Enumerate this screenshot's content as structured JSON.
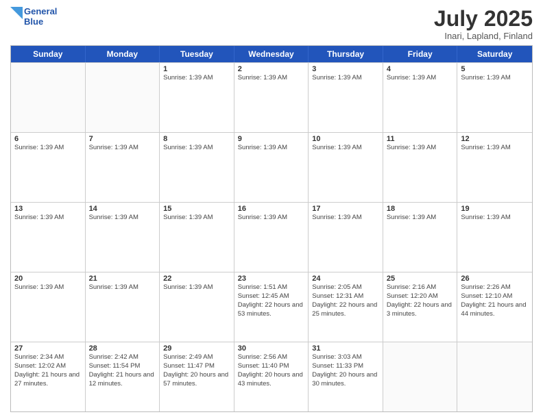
{
  "logo": {
    "line1": "General",
    "line2": "Blue"
  },
  "title": "July 2025",
  "location": "Inari, Lapland, Finland",
  "header_days": [
    "Sunday",
    "Monday",
    "Tuesday",
    "Wednesday",
    "Thursday",
    "Friday",
    "Saturday"
  ],
  "weeks": [
    [
      {
        "day": "",
        "info": ""
      },
      {
        "day": "",
        "info": ""
      },
      {
        "day": "1",
        "info": "Sunrise: 1:39 AM"
      },
      {
        "day": "2",
        "info": "Sunrise: 1:39 AM"
      },
      {
        "day": "3",
        "info": "Sunrise: 1:39 AM"
      },
      {
        "day": "4",
        "info": "Sunrise: 1:39 AM"
      },
      {
        "day": "5",
        "info": "Sunrise: 1:39 AM"
      }
    ],
    [
      {
        "day": "6",
        "info": "Sunrise: 1:39 AM"
      },
      {
        "day": "7",
        "info": "Sunrise: 1:39 AM"
      },
      {
        "day": "8",
        "info": "Sunrise: 1:39 AM"
      },
      {
        "day": "9",
        "info": "Sunrise: 1:39 AM"
      },
      {
        "day": "10",
        "info": "Sunrise: 1:39 AM"
      },
      {
        "day": "11",
        "info": "Sunrise: 1:39 AM"
      },
      {
        "day": "12",
        "info": "Sunrise: 1:39 AM"
      }
    ],
    [
      {
        "day": "13",
        "info": "Sunrise: 1:39 AM"
      },
      {
        "day": "14",
        "info": "Sunrise: 1:39 AM"
      },
      {
        "day": "15",
        "info": "Sunrise: 1:39 AM"
      },
      {
        "day": "16",
        "info": "Sunrise: 1:39 AM"
      },
      {
        "day": "17",
        "info": "Sunrise: 1:39 AM"
      },
      {
        "day": "18",
        "info": "Sunrise: 1:39 AM"
      },
      {
        "day": "19",
        "info": "Sunrise: 1:39 AM"
      }
    ],
    [
      {
        "day": "20",
        "info": "Sunrise: 1:39 AM"
      },
      {
        "day": "21",
        "info": "Sunrise: 1:39 AM"
      },
      {
        "day": "22",
        "info": "Sunrise: 1:39 AM"
      },
      {
        "day": "23",
        "info": "Sunrise: 1:51 AM\nSunset: 12:45 AM\nDaylight: 22 hours and 53 minutes."
      },
      {
        "day": "24",
        "info": "Sunrise: 2:05 AM\nSunset: 12:31 AM\nDaylight: 22 hours and 25 minutes."
      },
      {
        "day": "25",
        "info": "Sunrise: 2:16 AM\nSunset: 12:20 AM\nDaylight: 22 hours and 3 minutes."
      },
      {
        "day": "26",
        "info": "Sunrise: 2:26 AM\nSunset: 12:10 AM\nDaylight: 21 hours and 44 minutes."
      }
    ],
    [
      {
        "day": "27",
        "info": "Sunrise: 2:34 AM\nSunset: 12:02 AM\nDaylight: 21 hours and 27 minutes."
      },
      {
        "day": "28",
        "info": "Sunrise: 2:42 AM\nSunset: 11:54 PM\nDaylight: 21 hours and 12 minutes."
      },
      {
        "day": "29",
        "info": "Sunrise: 2:49 AM\nSunset: 11:47 PM\nDaylight: 20 hours and 57 minutes."
      },
      {
        "day": "30",
        "info": "Sunrise: 2:56 AM\nSunset: 11:40 PM\nDaylight: 20 hours and 43 minutes."
      },
      {
        "day": "31",
        "info": "Sunrise: 3:03 AM\nSunset: 11:33 PM\nDaylight: 20 hours and 30 minutes."
      },
      {
        "day": "",
        "info": ""
      },
      {
        "day": "",
        "info": ""
      }
    ]
  ]
}
